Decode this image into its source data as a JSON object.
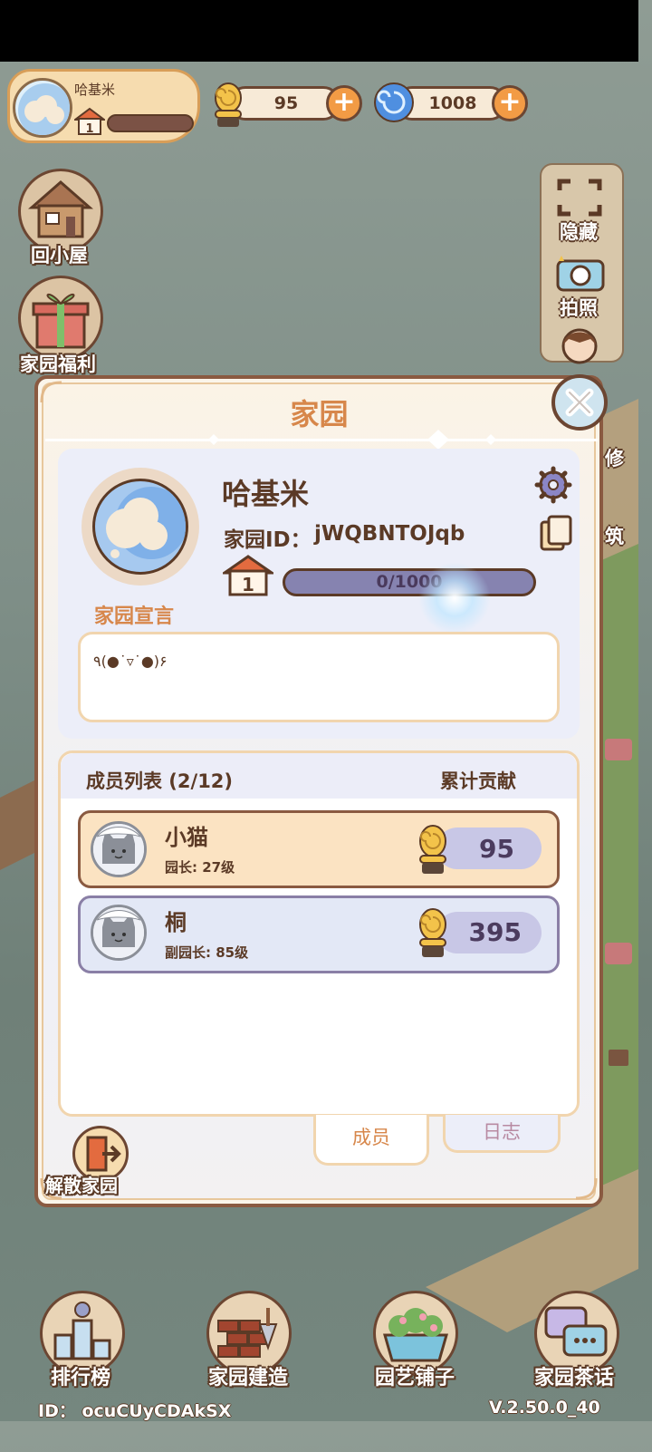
{
  "header": {
    "profile_name": "哈基米",
    "level": "1",
    "currency_snail": "95",
    "currency_swirl": "1008",
    "plus_label": "+"
  },
  "left_menu": {
    "back_home": "回小屋",
    "welfare": "家园福利"
  },
  "right_menu": {
    "hide": "隐藏",
    "photo": "拍照",
    "repair_partial": "修",
    "build_partial": "筑"
  },
  "panel": {
    "title": "家园",
    "home_name": "哈基米",
    "home_id_label": "家园ID：",
    "home_id": "jWQBNTOJqb",
    "level": "1",
    "progress_text": "0/1000",
    "progress_fraction": 0,
    "declaration_label": "家园宣言",
    "declaration_text": "٩(●˙▿˙●)۶",
    "members_title": "成员列表 (2/12)",
    "contribution_title": "累计贡献",
    "members": [
      {
        "name": "小猫",
        "role": "园长: 27级",
        "score": "95"
      },
      {
        "name": "桐",
        "role": "副园长: 85级",
        "score": "395"
      }
    ],
    "tabs": {
      "members": "成员",
      "log": "日志"
    },
    "dissolve": "解散家园"
  },
  "bottom_nav": {
    "ranking": "排行榜",
    "build": "家园建造",
    "shop": "园艺铺子",
    "chat": "家园茶话"
  },
  "footer": {
    "id_text": "ID： ocuCUyCDAkSX",
    "version": "V.2.50.0_40"
  },
  "colors": {
    "accent_orange": "#d7874b",
    "panel_border": "#8a5a41",
    "owner_row": "#fbe3c2",
    "member_row": "#e3e8f6"
  }
}
